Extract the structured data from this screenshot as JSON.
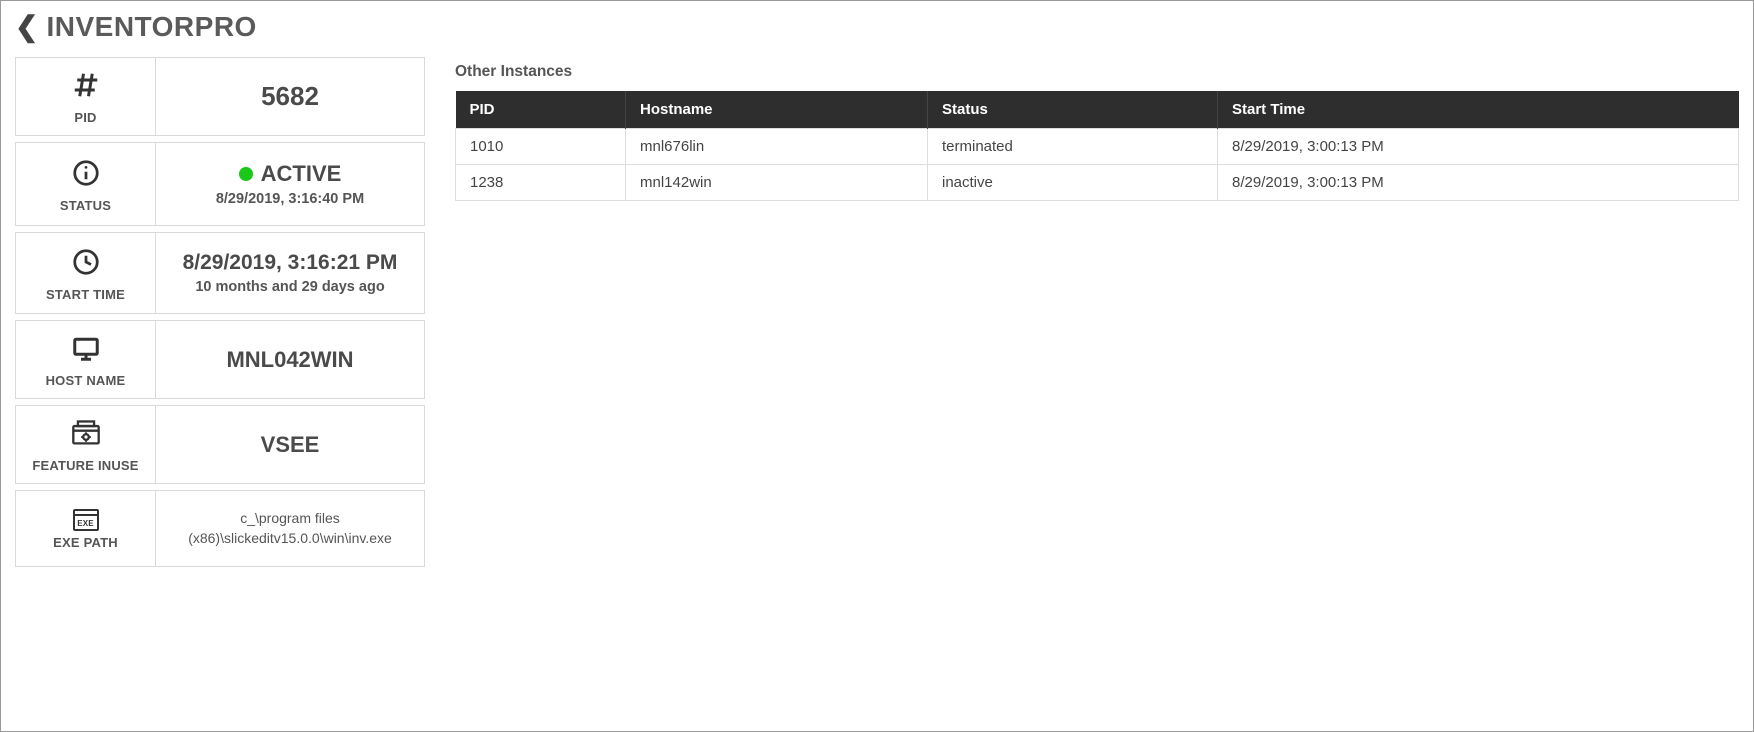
{
  "header": {
    "title": "INVENTORPRO"
  },
  "cards": {
    "pid": {
      "label": "PID",
      "value": "5682"
    },
    "status": {
      "label": "STATUS",
      "value": "ACTIVE",
      "timestamp": "8/29/2019, 3:16:40 PM"
    },
    "start_time": {
      "label": "START TIME",
      "value": "8/29/2019, 3:16:21 PM",
      "ago": "10 months and 29 days ago"
    },
    "host_name": {
      "label": "HOST NAME",
      "value": "MNL042WIN"
    },
    "feature_inuse": {
      "label": "FEATURE INUSE",
      "value": "VSEE"
    },
    "exe_path": {
      "label": "EXE PATH",
      "value": "c_\\program files (x86)\\slickeditv15.0.0\\win\\inv.exe"
    }
  },
  "other": {
    "title": "Other Instances",
    "headers": {
      "pid": "PID",
      "hostname": "Hostname",
      "status": "Status",
      "start_time": "Start Time"
    },
    "rows": [
      {
        "pid": "1010",
        "hostname": "mnl676lin",
        "status": "terminated",
        "start_time": "8/29/2019, 3:00:13 PM"
      },
      {
        "pid": "1238",
        "hostname": "mnl142win",
        "status": "inactive",
        "start_time": "8/29/2019, 3:00:13 PM"
      }
    ]
  }
}
